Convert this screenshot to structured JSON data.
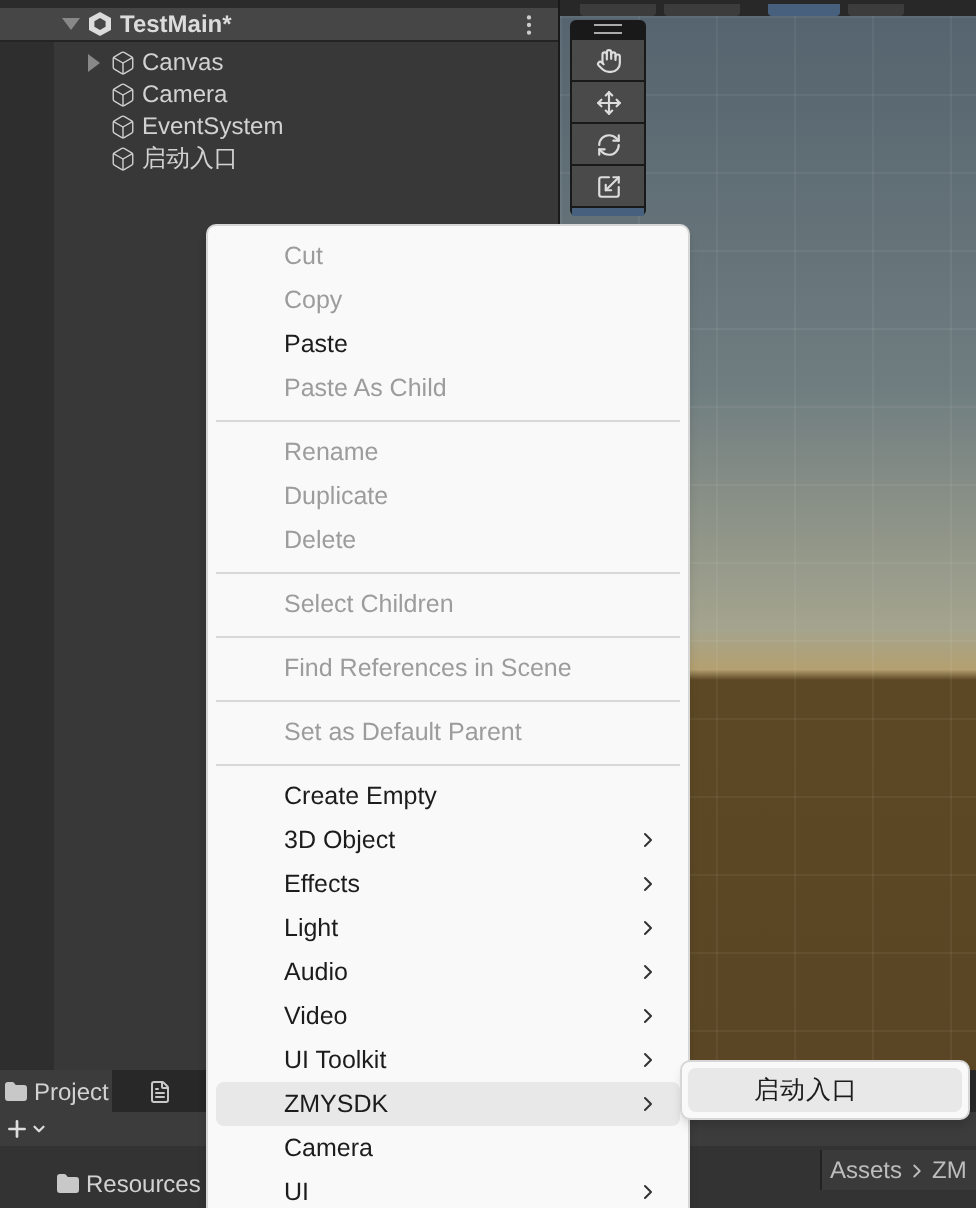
{
  "hierarchy": {
    "scene": "TestMain*",
    "items": [
      {
        "label": "Canvas",
        "kind": "group"
      },
      {
        "label": "Camera",
        "kind": "object"
      },
      {
        "label": "EventSystem",
        "kind": "object"
      },
      {
        "label": "启动入口",
        "kind": "object"
      }
    ]
  },
  "context_menu": {
    "sections": [
      [
        {
          "label": "Cut",
          "disabled": true,
          "submenu": false,
          "selected": false
        },
        {
          "label": "Copy",
          "disabled": true,
          "submenu": false,
          "selected": false
        },
        {
          "label": "Paste",
          "disabled": false,
          "submenu": false,
          "selected": false
        },
        {
          "label": "Paste As Child",
          "disabled": true,
          "submenu": false,
          "selected": false
        }
      ],
      [
        {
          "label": "Rename",
          "disabled": true,
          "submenu": false,
          "selected": false
        },
        {
          "label": "Duplicate",
          "disabled": true,
          "submenu": false,
          "selected": false
        },
        {
          "label": "Delete",
          "disabled": true,
          "submenu": false,
          "selected": false
        }
      ],
      [
        {
          "label": "Select Children",
          "disabled": true,
          "submenu": false,
          "selected": false
        }
      ],
      [
        {
          "label": "Find References in Scene",
          "disabled": true,
          "submenu": false,
          "selected": false
        }
      ],
      [
        {
          "label": "Set as Default Parent",
          "disabled": true,
          "submenu": false,
          "selected": false
        }
      ],
      [
        {
          "label": "Create Empty",
          "disabled": false,
          "submenu": false,
          "selected": false
        },
        {
          "label": "3D Object",
          "disabled": false,
          "submenu": true,
          "selected": false
        },
        {
          "label": "Effects",
          "disabled": false,
          "submenu": true,
          "selected": false
        },
        {
          "label": "Light",
          "disabled": false,
          "submenu": true,
          "selected": false
        },
        {
          "label": "Audio",
          "disabled": false,
          "submenu": true,
          "selected": false
        },
        {
          "label": "Video",
          "disabled": false,
          "submenu": true,
          "selected": false
        },
        {
          "label": "UI Toolkit",
          "disabled": false,
          "submenu": true,
          "selected": false
        },
        {
          "label": "ZMYSDK",
          "disabled": false,
          "submenu": true,
          "selected": true
        },
        {
          "label": "Camera",
          "disabled": false,
          "submenu": false,
          "selected": false
        },
        {
          "label": "UI",
          "disabled": false,
          "submenu": true,
          "selected": false
        }
      ]
    ]
  },
  "submenu": {
    "items": [
      {
        "label": "启动入口",
        "selected": true
      }
    ]
  },
  "project_panel": {
    "tabs": [
      {
        "label": "Project",
        "selected": true
      }
    ],
    "folders": [
      "Resources"
    ],
    "breadcrumb": [
      "Assets",
      "ZM"
    ]
  }
}
